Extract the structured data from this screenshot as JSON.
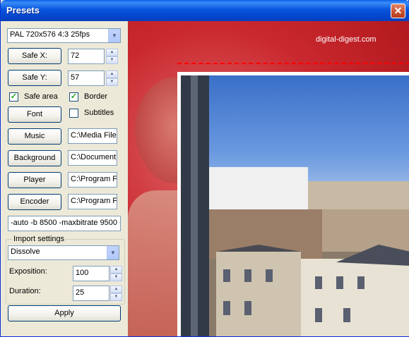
{
  "window": {
    "title": "Presets",
    "close_glyph": "✕"
  },
  "format": {
    "selected": "PAL  720x576 4:3 25fps",
    "arrow": "▼"
  },
  "safe_x": {
    "label": "Safe X:",
    "value": "72"
  },
  "safe_y": {
    "label": "Safe Y:",
    "value": "57"
  },
  "spin_glyphs": {
    "up": "▲",
    "down": "▼"
  },
  "checkboxes": {
    "safe_area": {
      "label": "Safe area",
      "checked": true
    },
    "border": {
      "label": "Border",
      "checked": true
    },
    "subtitles": {
      "label": "Subtitles",
      "checked": false
    },
    "check_glyph": "✓"
  },
  "font": {
    "label": "Font"
  },
  "music": {
    "label": "Music",
    "path": "C:\\Media File"
  },
  "background": {
    "label": "Background",
    "path": "C:\\Document"
  },
  "player": {
    "label": "Player",
    "path": "C:\\Program F"
  },
  "encoder": {
    "label": "Encoder",
    "path": "C:\\Program F"
  },
  "encoder_args": "-auto -b 8500 -maxbitrate 9500 -",
  "import_settings": {
    "title": "Import settings",
    "transition": "Dissolve",
    "exposition_label": "Exposition:",
    "exposition_value": "100",
    "duration_label": "Duration:",
    "duration_value": "25"
  },
  "apply": {
    "label": "Apply"
  },
  "preview": {
    "watermark": "digital-digest.com"
  }
}
